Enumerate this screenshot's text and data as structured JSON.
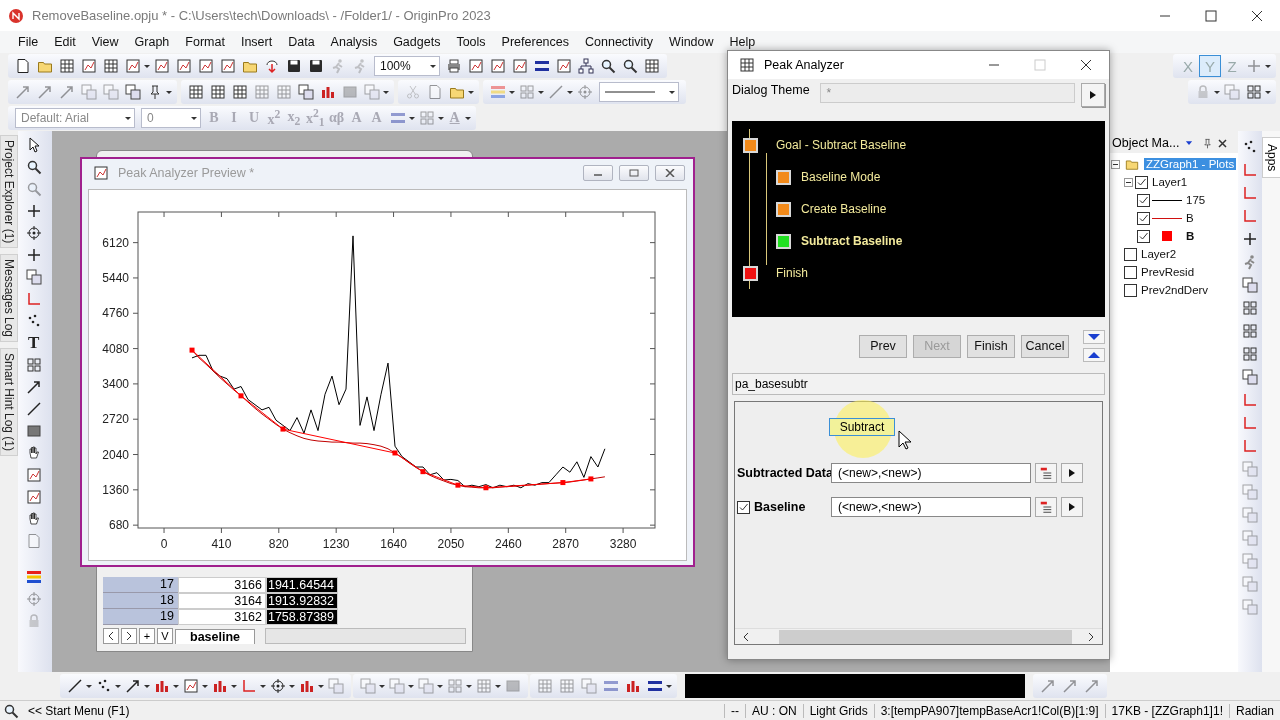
{
  "window": {
    "title": "RemoveBaseline.opju * - C:\\Users\\tech\\Downloads\\ - /Folder1/ - OriginPro 2023"
  },
  "menu": [
    "File",
    "Edit",
    "View",
    "Graph",
    "Format",
    "Insert",
    "Data",
    "Analysis",
    "Gadgets",
    "Tools",
    "Preferences",
    "Connectivity",
    "Window",
    "Help"
  ],
  "toolbar": {
    "zoom": "100%",
    "font": "Default: Arial",
    "font_size": "0",
    "format_buttons": [
      {
        "label": "B",
        "disabled": true
      },
      {
        "label": "I",
        "disabled": true
      },
      {
        "label": "U",
        "disabled": true
      },
      {
        "label": "x$^{2}$",
        "disabled": true
      },
      {
        "label": "x$_{2}$",
        "disabled": true
      },
      {
        "label": "x$^{2}$$_{1}$",
        "disabled": true
      },
      {
        "label": "αβ",
        "disabled": true
      },
      {
        "label": "A",
        "disabled": true
      },
      {
        "label": "A",
        "disabled": true
      }
    ],
    "font_color": "A",
    "axis_buttons": [
      {
        "label": "X",
        "selected": false
      },
      {
        "label": "Y",
        "selected": true
      },
      {
        "label": "Z",
        "selected": false
      }
    ]
  },
  "side_tabs": [
    "Project Explorer (1)",
    "Messages Log",
    "Smart Hint Log (1)"
  ],
  "tools": {
    "text_tool": "T"
  },
  "worksheet": {
    "columns": [
      {
        "selected": false
      },
      {
        "selected": true
      }
    ],
    "rows": [
      {
        "label": "17",
        "cells": [
          "3166",
          "1941.64544"
        ]
      },
      {
        "label": "18",
        "cells": [
          "3164",
          "1913.92832"
        ]
      },
      {
        "label": "19",
        "cells": [
          "3162",
          "1758.87389"
        ]
      }
    ],
    "nav_buttons": [
      "+",
      "V"
    ],
    "sheet_tab": "baseline"
  },
  "graph_window": {
    "title": "Peak Analyzer Preview *",
    "active": false,
    "chart_data": {
      "type": "line",
      "xlim": [
        -186,
        3508
      ],
      "ylim": [
        625,
        6710
      ],
      "xticks": [
        0,
        410,
        820,
        1230,
        1640,
        2050,
        2460,
        2870,
        3280
      ],
      "yticks": [
        680,
        1360,
        2040,
        2720,
        3400,
        4080,
        4760,
        5440,
        6120
      ],
      "x": [
        200,
        250,
        300,
        350,
        400,
        450,
        500,
        550,
        600,
        650,
        700,
        750,
        800,
        850,
        900,
        950,
        1000,
        1050,
        1100,
        1150,
        1200,
        1250,
        1300,
        1350,
        1400,
        1450,
        1500,
        1550,
        1600,
        1650,
        1700,
        1750,
        1800,
        1850,
        1900,
        1950,
        2000,
        2050,
        2100,
        2150,
        2200,
        2250,
        2300,
        2350,
        2400,
        2450,
        2500,
        2550,
        2600,
        2650,
        2700,
        2750,
        2800,
        2850,
        2900,
        2950,
        3000,
        3050,
        3100,
        3150
      ],
      "series": [
        {
          "color": "#000000",
          "values": [
            3900,
            3950,
            3950,
            3650,
            3550,
            3500,
            3300,
            3350,
            3100,
            3000,
            2900,
            2950,
            2700,
            2600,
            2500,
            2750,
            2450,
            2900,
            2500,
            3200,
            3550,
            3000,
            3300,
            6250,
            2600,
            3150,
            2500,
            3200,
            3800,
            2200,
            2000,
            1900,
            1800,
            1800,
            1650,
            1690,
            1550,
            1560,
            1540,
            1420,
            1450,
            1420,
            1460,
            1400,
            1450,
            1420,
            1450,
            1400,
            1480,
            1450,
            1500,
            1500,
            1650,
            1800,
            1700,
            1900,
            1600,
            2000,
            1800,
            2150
          ]
        },
        {
          "color": "#c00000",
          "values": [
            4050,
            3900,
            3780,
            3650,
            3520,
            3400,
            3280,
            3170,
            3050,
            2930,
            2820,
            2720,
            2620,
            2530,
            2460,
            2400,
            2350,
            2320,
            2300,
            2290,
            2280,
            2280,
            2270,
            2260,
            2260,
            2250,
            2230,
            2200,
            2150,
            2070,
            1980,
            1880,
            1790,
            1710,
            1640,
            1580,
            1530,
            1480,
            1450,
            1420,
            1410,
            1400,
            1400,
            1400,
            1410,
            1420,
            1430,
            1440,
            1450,
            1460,
            1470,
            1480,
            1490,
            1500,
            1510,
            1530,
            1550,
            1570,
            1590,
            1610
          ]
        },
        {
          "color": "#ff0000",
          "marker": "square",
          "values": [
            4050,
            null,
            null,
            null,
            null,
            null,
            null,
            3170,
            null,
            null,
            null,
            null,
            null,
            2530,
            null,
            null,
            null,
            null,
            null,
            null,
            null,
            null,
            null,
            null,
            null,
            null,
            null,
            null,
            null,
            2070,
            null,
            null,
            null,
            1710,
            null,
            null,
            null,
            null,
            1450,
            null,
            null,
            null,
            1400,
            null,
            null,
            null,
            null,
            null,
            null,
            null,
            null,
            null,
            null,
            1500,
            null,
            null,
            null,
            1570,
            null,
            null
          ]
        }
      ]
    }
  },
  "dialog": {
    "title": "Peak Analyzer",
    "theme_label": "Dialog Theme",
    "theme_value": "*",
    "steps": [
      {
        "label": "Goal - Subtract Baseline",
        "color": "#f28a1a",
        "selected": false,
        "children": [
          {
            "label": "Baseline Mode",
            "color": "#f28a1a",
            "selected": false
          },
          {
            "label": "Create Baseline",
            "color": "#f28a1a",
            "selected": false
          },
          {
            "label": "Subtract Baseline",
            "color": "#22e022",
            "selected": true
          }
        ]
      },
      {
        "label": "Finish",
        "color": "#ee1111",
        "selected": false
      }
    ],
    "buttons": [
      {
        "label": "Prev",
        "disabled": false
      },
      {
        "label": "Next",
        "disabled": true
      },
      {
        "label": "Finish",
        "disabled": false
      },
      {
        "label": "Cancel",
        "disabled": false
      }
    ],
    "path": "pa_basesubtr",
    "action_button": "Subtract",
    "outputs": [
      {
        "kind": "plain",
        "label": "Subtracted Data",
        "value": "(<new>,<new>)"
      },
      {
        "kind": "checkbox",
        "label": "Baseline",
        "checked": true,
        "value": "(<new>,<new>)"
      }
    ]
  },
  "object_manager": {
    "title": "Object Ma...",
    "tree": [
      {
        "label": "ZZGraph1 - Plots",
        "selected": true,
        "expanded": true,
        "children": [
          {
            "label": "Layer1",
            "selected": false,
            "checked": true,
            "expanded": true,
            "children": [
              {
                "label": "175",
                "selected": false,
                "checked": true,
                "kind": "line",
                "color": "#000000",
                "active": false
              },
              {
                "label": "B",
                "selected": false,
                "checked": true,
                "kind": "line",
                "color": "#d01010",
                "active": false
              },
              {
                "label": "B",
                "selected": false,
                "checked": true,
                "kind": "marker",
                "color": "#ff0000",
                "active": true
              }
            ]
          },
          {
            "label": "Layer2",
            "selected": false,
            "checked": false
          },
          {
            "label": "PrevResid",
            "selected": false,
            "checked": false
          },
          {
            "label": "Prev2ndDerv",
            "selected": false,
            "checked": false
          }
        ]
      }
    ]
  },
  "apps_tab": "Apps",
  "status_bar": [
    "<< Start Menu (F1)",
    "--",
    "AU : ON",
    "Light Grids",
    "3:[tempPA907]tempBaseAcr1!Col(B)[1:9]",
    "17KB - [ZZGraph1]1!",
    "Radian"
  ]
}
